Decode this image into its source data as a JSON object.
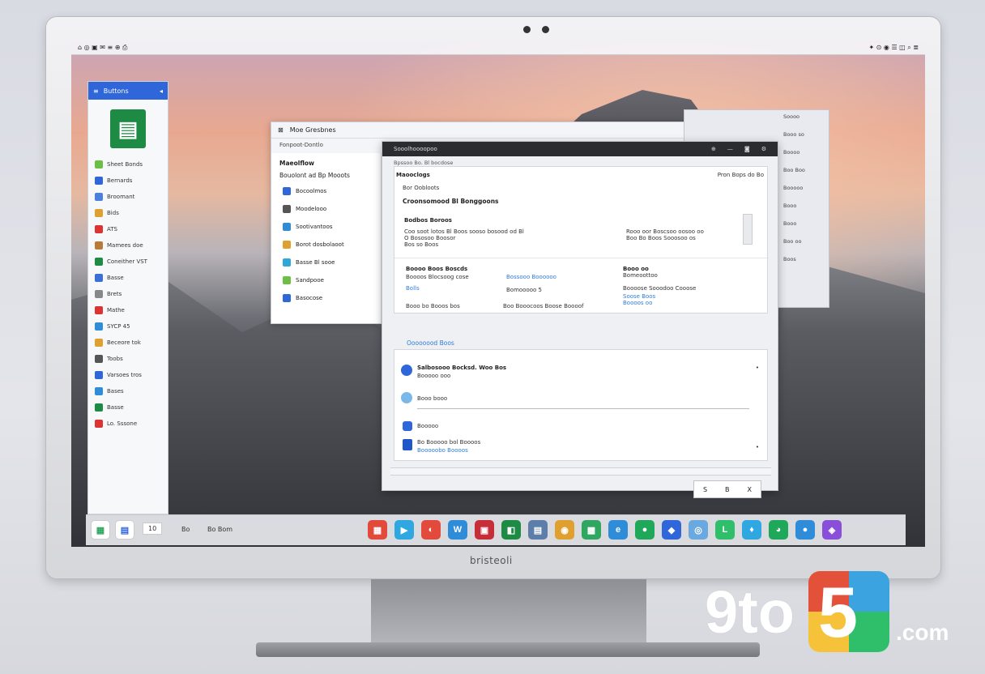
{
  "topbar": {
    "left": "⌂  ◎  ▣  ✉  ≡  ⊕  ⎙",
    "right": "✦  ⊙  ◉  ☰  ◫  ⌕  ≣"
  },
  "sidebar": {
    "header": "Buttons",
    "items": [
      {
        "label": "Sheet Bonds",
        "color": "#6cbf45"
      },
      {
        "label": "Bernards",
        "color": "#2f66d9"
      },
      {
        "label": "Broomant",
        "color": "#4b7fe0"
      },
      {
        "label": "Bids",
        "color": "#e0a030"
      },
      {
        "label": "ATS",
        "color": "#d33"
      },
      {
        "label": "Mamees doe",
        "color": "#b87a3a"
      },
      {
        "label": "Coneither VST",
        "color": "#1e8b45"
      },
      {
        "label": "Basse",
        "color": "#3a6fd8"
      },
      {
        "label": "Brets",
        "color": "#888"
      },
      {
        "label": "Mathe",
        "color": "#d33"
      },
      {
        "label": "SYCP 45",
        "color": "#2f8cd8"
      },
      {
        "label": "Beceore tok",
        "color": "#e0a030"
      },
      {
        "label": "Toobs",
        "color": "#555"
      },
      {
        "label": "Varsoes tros",
        "color": "#2f66d9"
      },
      {
        "label": "Bases",
        "color": "#2f8cd8"
      },
      {
        "label": "Basse",
        "color": "#1e8b45"
      },
      {
        "label": "Lo. Sssone",
        "color": "#d33"
      }
    ]
  },
  "win_back": {
    "title": "Moe Gresbnes",
    "subtitle": "Fonpoot-Dontlo",
    "list_header": "Maeolflow",
    "list_sub": "Bouolont ad Bp Mooots",
    "items": [
      {
        "label": "Bocoolmos",
        "color": "#2f66d9"
      },
      {
        "label": "Moodelooo",
        "color": "#555"
      },
      {
        "label": "Sootivantoos",
        "color": "#2f8cd8"
      },
      {
        "label": "Borot dosbolaoot",
        "color": "#e0a030"
      },
      {
        "label": "Basse Bl sooe",
        "color": "#2fa7d8"
      },
      {
        "label": "Sandpooe",
        "color": "#6cbf45"
      },
      {
        "label": "Basocose",
        "color": "#2f66d9"
      }
    ]
  },
  "panel": {
    "darkbar": "Sooolhoooopoo",
    "crumb": "Bpssoo Bo. Bl bocdose",
    "title": "Maooclogs",
    "sub": "Bor Oobloots",
    "search": "Pron Bops do Bo",
    "section": "Croonsomood Bl Bonggoons",
    "section2": "Bodbos Boroos",
    "desc1": "Coo soot lotos Bl Boos sooso bosood od Bl",
    "desc2": "O Bososoo Boosor",
    "desc3": "Bos so Boos",
    "right1": "Rooo oor Boscsoo oosoo oo",
    "right2": "Boo Bo Boos Sooosoo os",
    "col1a": "Boooo Boos Boscds",
    "col1b": "Boooos Blocsoog cose",
    "col1c": "Bolls",
    "col2a": "Bossooo Boooooo",
    "col2b": "Bomooooo 5",
    "col3a": "Booo oo",
    "col3b": "Bomeoottoo",
    "col3c": "Boooose Sooodoo Cooose",
    "col3d": "Soose Boos",
    "col3e": "Boooos oo",
    "foot1": "Booo bo Booos bos",
    "foot2": "Boo Booocoos Boose Boooof",
    "link_section": "Oooooood Boos",
    "msg1": "Salbosooo Bocksd. Woo Bos",
    "msg1b": "Booooo ooo",
    "msg2": "Booo booo",
    "msg3": "Booooo",
    "msg4": "Bo Booooo bol Boooos",
    "msg4b": "Booooobo Boooos",
    "btn1": "S",
    "btn2": "B",
    "btn3": "X"
  },
  "panel_side": {
    "lines": [
      "Soooo",
      "Booo so",
      "Boooo",
      "Boo Boo",
      "Booooo",
      "Booo",
      "Booo",
      "Boo oo",
      "Boos"
    ]
  },
  "dock": {
    "left_labels": [
      "10",
      "Bo",
      "Bo Bom"
    ],
    "icons": [
      {
        "glyph": "▦",
        "color": "#e24a3b"
      },
      {
        "glyph": "▶",
        "color": "#2fa7e0"
      },
      {
        "glyph": "◐",
        "color": "#e24a3b"
      },
      {
        "glyph": "W",
        "color": "#2f8cd8"
      },
      {
        "glyph": "▣",
        "color": "#c62f3a"
      },
      {
        "glyph": "◧",
        "color": "#1e8b45"
      },
      {
        "glyph": "▤",
        "color": "#5c7ea8"
      },
      {
        "glyph": "◉",
        "color": "#e0a030"
      },
      {
        "glyph": "▩",
        "color": "#2fa760"
      },
      {
        "glyph": "e",
        "color": "#2f8cd8"
      },
      {
        "glyph": "●",
        "color": "#1fa85a"
      },
      {
        "glyph": "◆",
        "color": "#2f66d9"
      },
      {
        "glyph": "◎",
        "color": "#6aa8e0"
      },
      {
        "glyph": "L",
        "color": "#2fbf6a"
      },
      {
        "glyph": "♦",
        "color": "#2fa7e0"
      },
      {
        "glyph": "◕",
        "color": "#1fa85a"
      },
      {
        "glyph": "●",
        "color": "#2f8cd8"
      },
      {
        "glyph": "◈",
        "color": "#8a4fd8"
      }
    ]
  },
  "chin_brand": "bristeoli",
  "logo": {
    "num": "9to",
    "digit": "5",
    "domain": ".com"
  }
}
